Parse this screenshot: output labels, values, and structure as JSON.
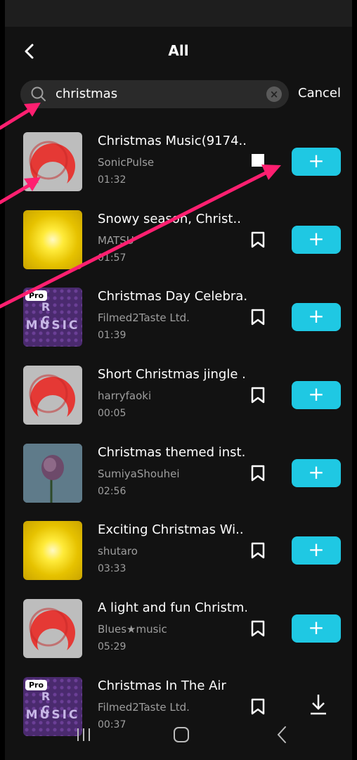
{
  "header": {
    "title": "All"
  },
  "search": {
    "query": "christmas",
    "cancel_label": "Cancel"
  },
  "tracks": [
    {
      "name": "Christmas Music(9174..",
      "artist": "SonicPulse",
      "duration": "01:32",
      "thumb": "red-c",
      "action": "add",
      "bookmark": "filled"
    },
    {
      "name": "Snowy season, Christ..",
      "artist": "MATSU",
      "duration": "01:57",
      "thumb": "yellow-burst",
      "action": "add",
      "bookmark": "outline"
    },
    {
      "name": "Christmas Day Celebra..",
      "artist": "Filmed2Taste Ltd.",
      "duration": "01:39",
      "thumb": "purple-music",
      "pro": "Pro",
      "thumb_text": "MUSIC",
      "thumb_text2": "R C",
      "action": "add",
      "bookmark": "outline"
    },
    {
      "name": "Short Christmas jingle ..",
      "artist": "harryfaoki",
      "duration": "00:05",
      "thumb": "red-c",
      "action": "add",
      "bookmark": "outline"
    },
    {
      "name": "Christmas themed inst..",
      "artist": "SumiyaShouhei",
      "duration": "02:56",
      "thumb": "rose",
      "action": "add",
      "bookmark": "outline"
    },
    {
      "name": "Exciting Christmas Wi..",
      "artist": "shutaro",
      "duration": "03:33",
      "thumb": "yellow-burst",
      "action": "add",
      "bookmark": "outline"
    },
    {
      "name": "A light and fun Christm..",
      "artist": "Blues★music",
      "duration": "05:29",
      "thumb": "red-c",
      "action": "add",
      "bookmark": "outline"
    },
    {
      "name": "Christmas In The Air",
      "artist": "Filmed2Taste Ltd.",
      "duration": "00:37",
      "thumb": "purple-music",
      "pro": "Pro",
      "thumb_text": "MUSIC",
      "thumb_text2": "R C",
      "action": "download",
      "bookmark": "outline"
    }
  ],
  "colors": {
    "accent": "#1fc8e3",
    "annotation_arrow": "#ff1f70",
    "background": "#121212"
  },
  "icons": {
    "back": "chevron-left-icon",
    "search": "search-icon",
    "clear": "clear-icon",
    "bookmark": "bookmark-icon",
    "add": "plus-icon",
    "download": "download-icon"
  }
}
